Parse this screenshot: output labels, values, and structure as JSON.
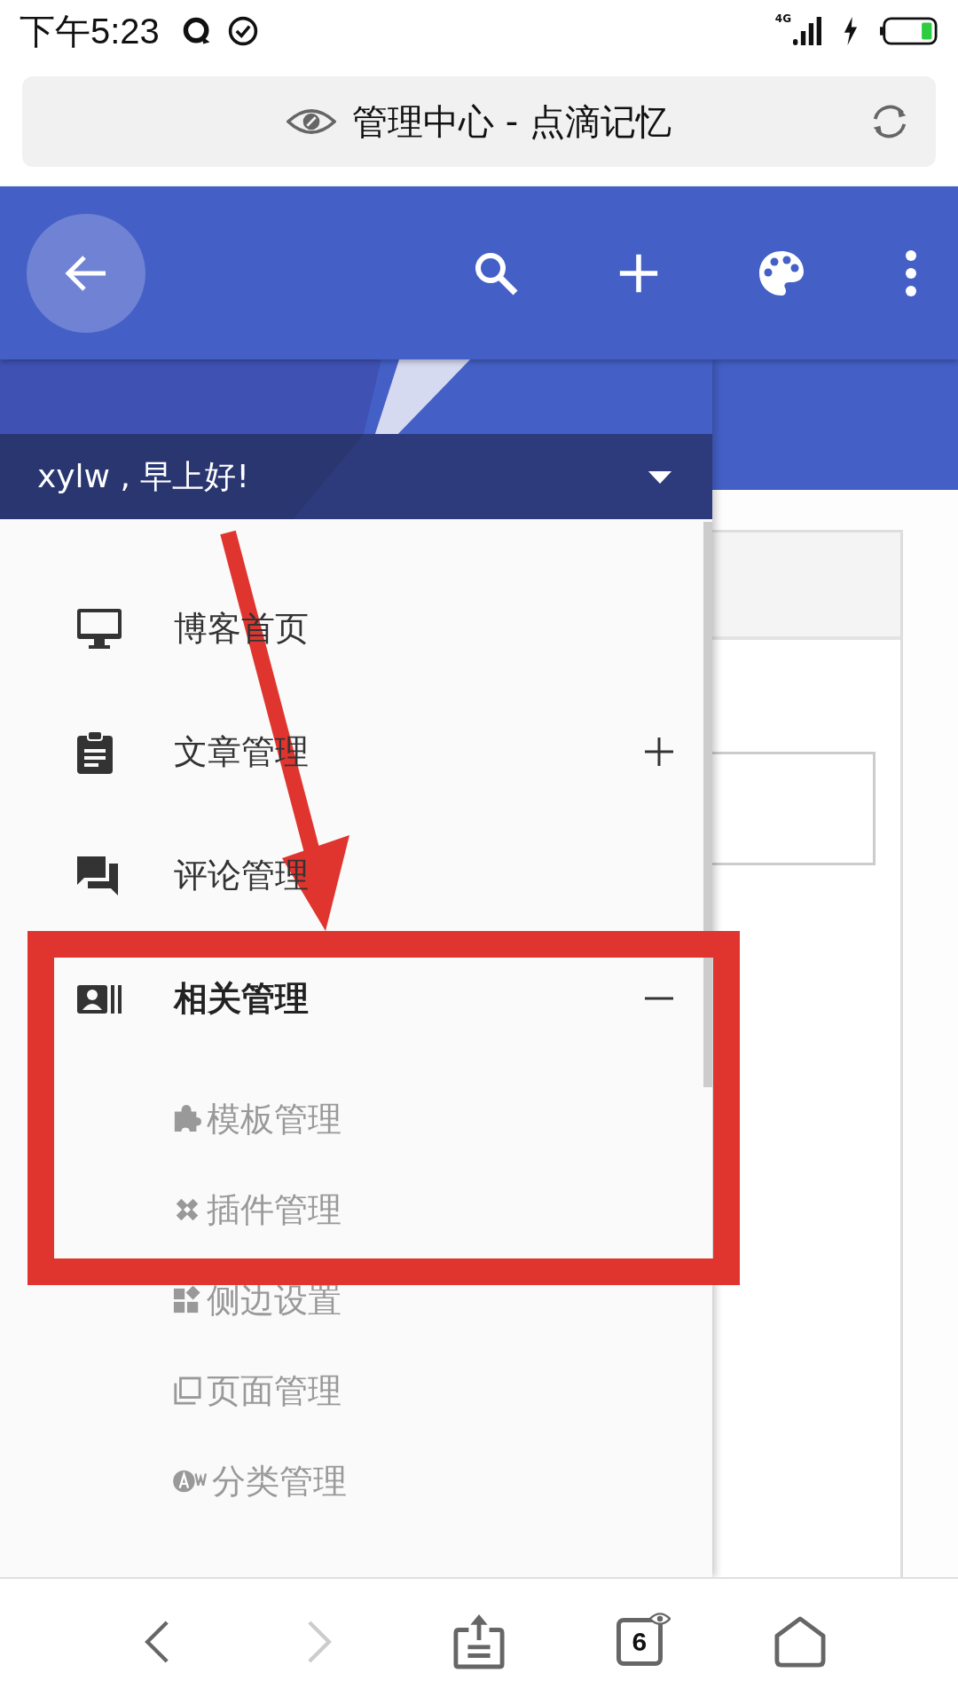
{
  "status_bar": {
    "time": "下午5:23",
    "network": "4G"
  },
  "address_bar": {
    "title": "管理中心 - 点滴记忆"
  },
  "drawer": {
    "greeting": "xylw , 早上好!",
    "items": [
      {
        "label": "博客首页"
      },
      {
        "label": "文章管理",
        "expanded": false
      },
      {
        "label": "评论管理"
      },
      {
        "label": "相关管理",
        "expanded": true,
        "children": [
          {
            "label": "模板管理"
          },
          {
            "label": "插件管理"
          },
          {
            "label": "侧边设置"
          },
          {
            "label": "页面管理"
          },
          {
            "label": "分类管理"
          }
        ]
      }
    ]
  },
  "bottom_nav": [
    {
      "kind": "back",
      "disabled": false
    },
    {
      "kind": "forward",
      "disabled": true
    },
    {
      "kind": "share",
      "disabled": false
    },
    {
      "kind": "tabs",
      "count": "6",
      "disabled": false
    },
    {
      "kind": "home",
      "disabled": false
    }
  ]
}
